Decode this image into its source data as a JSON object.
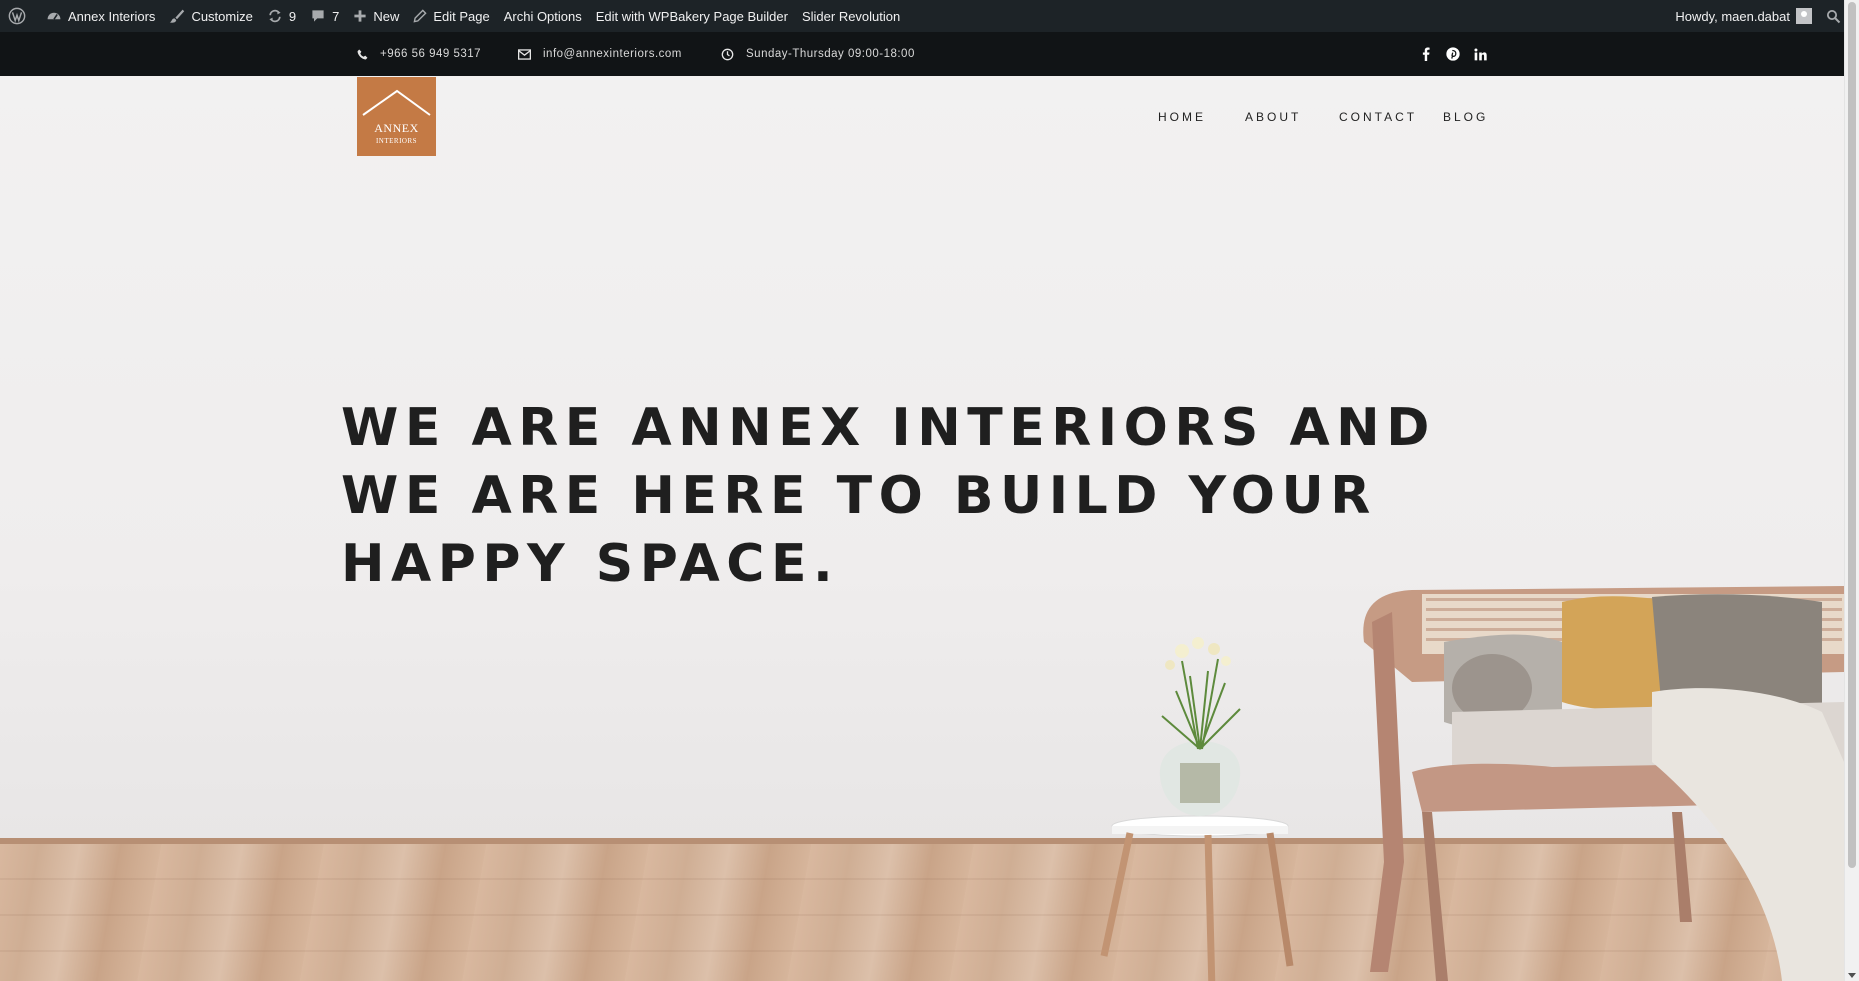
{
  "admin_bar": {
    "site_name": "Annex Interiors",
    "customize": "Customize",
    "updates_count": "9",
    "comments_count": "7",
    "new": "New",
    "edit_page": "Edit Page",
    "archi_options": "Archi Options",
    "wpbakery": "Edit with WPBakery Page Builder",
    "slider_revolution": "Slider Revolution",
    "howdy": "Howdy, maen.dabat"
  },
  "top_bar": {
    "phone": "+966 56 949 5317",
    "email": "info@annexinteriors.com",
    "hours": "Sunday-Thursday 09:00-18:00",
    "social_icons": [
      "facebook-icon",
      "pinterest-icon",
      "linkedin-icon"
    ]
  },
  "logo": {
    "line1": "ANNEX",
    "line2": "INTERIORS",
    "color": "#c47a45"
  },
  "nav": {
    "home": "HOME",
    "about": "ABOUT",
    "contact": "CONTACT",
    "blog": "BLOG"
  },
  "hero": {
    "line1": "WE ARE ANNEX INTERIORS AND",
    "line2": "WE ARE HERE TO BUILD YOUR",
    "line3": "HAPPY SPACE."
  },
  "colors": {
    "admin_bar": "#1d2327",
    "top_bar": "#111416",
    "headline": "#1f1f1f",
    "accent": "#c47a45"
  }
}
